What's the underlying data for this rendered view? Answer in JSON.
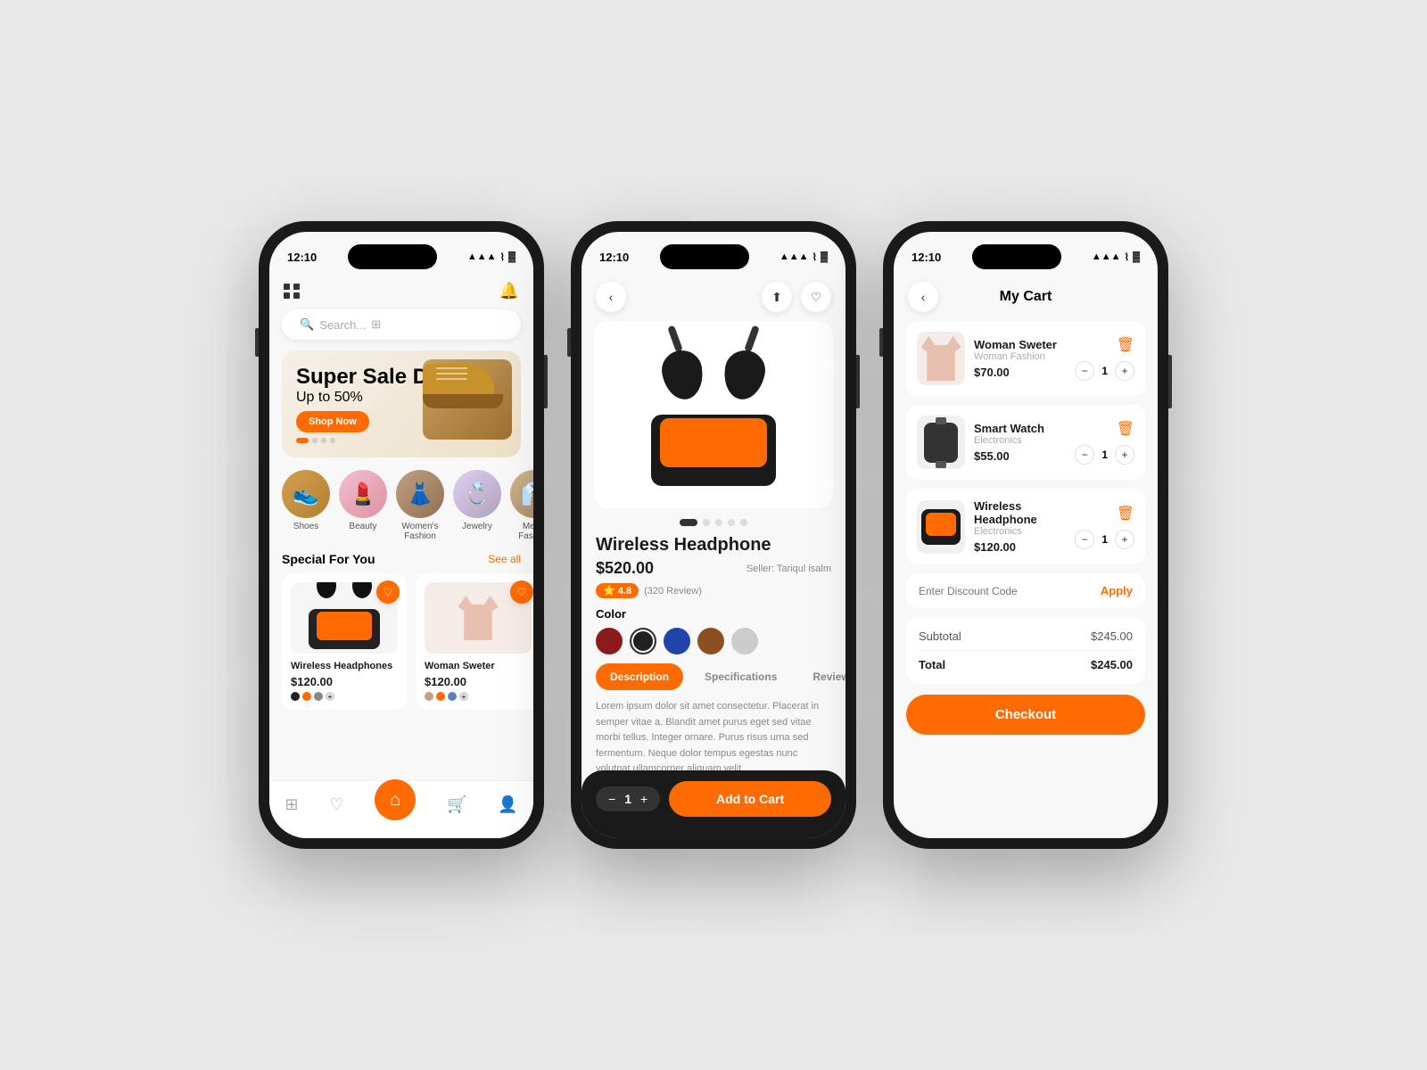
{
  "phones": {
    "phone1": {
      "status_time": "12:10",
      "search_placeholder": "Search...",
      "banner": {
        "title": "Super Sale Discount",
        "subtitle": "Up to 50%",
        "button": "Shop Now"
      },
      "categories": [
        {
          "id": "shoes",
          "label": "Shoes",
          "emoji": "👟"
        },
        {
          "id": "beauty",
          "label": "Beauty",
          "emoji": "💄"
        },
        {
          "id": "womens",
          "label": "Women's Fashion",
          "emoji": "👗"
        },
        {
          "id": "jewelry",
          "label": "Jewelry",
          "emoji": "💍"
        },
        {
          "id": "mens",
          "label": "Men's Fashion",
          "emoji": "👔"
        }
      ],
      "special_section": {
        "title": "Special For You",
        "see_all": "See all"
      },
      "products": [
        {
          "name": "Wireless Headphones",
          "price": "$120.00",
          "colors": [
            "#222",
            "#ff6b00",
            "#888"
          ]
        },
        {
          "name": "Woman Sweter",
          "price": "$120.00",
          "colors": [
            "#c8a080",
            "#ff6b00",
            "#6080c0"
          ]
        }
      ],
      "nav_items": [
        "grid",
        "heart",
        "home",
        "cart",
        "user"
      ]
    },
    "phone2": {
      "status_time": "12:10",
      "product": {
        "name": "Wireless Headphone",
        "price": "$520.00",
        "seller": "Seller: Tariqul isalm",
        "rating": "4.8",
        "review_count": "(320 Review)",
        "color_label": "Color",
        "colors": [
          "#8b1a1a",
          "#222",
          "#2244aa",
          "#8b5020",
          "#cccccc"
        ],
        "selected_color": 1
      },
      "tabs": [
        "Description",
        "Specifications",
        "Reviews"
      ],
      "active_tab": "Description",
      "description": "Lorem ipsum dolor sit amet consectetur. Placerat in semper vitae a. Blandit amet purus eget sed vitae morbi tellus. Integer ornare. Purus risus urna sed fermentum. Neque dolor tempus egestas nunc volutpat ullamcorper aliquam velit",
      "quantity": "1",
      "add_to_cart": "Add to Cart"
    },
    "phone3": {
      "status_time": "12:10",
      "title": "My Cart",
      "items": [
        {
          "name": "Woman Sweter",
          "category": "Woman Fashion",
          "price": "$70.00",
          "qty": "1"
        },
        {
          "name": "Smart Watch",
          "category": "Electronics",
          "price": "$55.00",
          "qty": "1"
        },
        {
          "name": "Wireless Headphone",
          "category": "Electronics",
          "price": "$120.00",
          "qty": "1"
        }
      ],
      "discount_placeholder": "Enter Discount Code",
      "apply_label": "Apply",
      "subtotal_label": "Subtotal",
      "subtotal_value": "$245.00",
      "total_label": "Total",
      "total_value": "$245.00",
      "checkout_label": "Checkout"
    }
  },
  "colors": {
    "primary": "#ff6b00",
    "dark": "#1a1a1a",
    "light": "#f8f8f8"
  }
}
